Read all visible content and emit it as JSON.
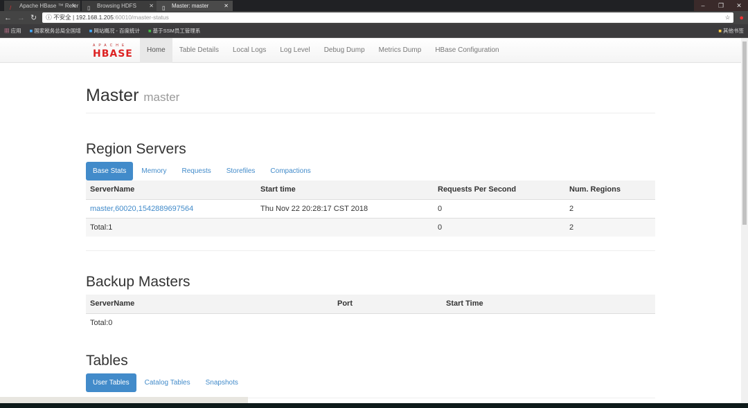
{
  "browser": {
    "tabs": [
      {
        "title": "Apache HBase ™ Refer",
        "active": false
      },
      {
        "title": "Browsing HDFS",
        "active": false
      },
      {
        "title": "Master: master",
        "active": true
      }
    ],
    "security_label": "不安全",
    "url_host": "192.168.1.205",
    "url_rest": ":60010/master-status",
    "bookmarks": [
      "应用",
      "国家税务总局全国增",
      "网站概况 - 百度统计",
      "基于SSM员工管理系"
    ],
    "other_bookmarks": "其他书签"
  },
  "logo": {
    "top": "APACHE",
    "main": "HBASE"
  },
  "nav": [
    "Home",
    "Table Details",
    "Local Logs",
    "Log Level",
    "Debug Dump",
    "Metrics Dump",
    "HBase Configuration"
  ],
  "page": {
    "title": "Master",
    "subtitle": "master"
  },
  "region_servers": {
    "heading": "Region Servers",
    "tabs": [
      "Base Stats",
      "Memory",
      "Requests",
      "Storefiles",
      "Compactions"
    ],
    "columns": [
      "ServerName",
      "Start time",
      "Requests Per Second",
      "Num. Regions"
    ],
    "rows": [
      [
        "master,60020,1542889697564",
        "Thu Nov 22 20:28:17 CST 2018",
        "0",
        "2"
      ]
    ],
    "total": [
      "Total:1",
      "",
      "0",
      "2"
    ]
  },
  "backup_masters": {
    "heading": "Backup Masters",
    "columns": [
      "ServerName",
      "Port",
      "Start Time"
    ],
    "total": "Total:0"
  },
  "tables": {
    "heading": "Tables",
    "tabs": [
      "User Tables",
      "Catalog Tables",
      "Snapshots"
    ]
  }
}
